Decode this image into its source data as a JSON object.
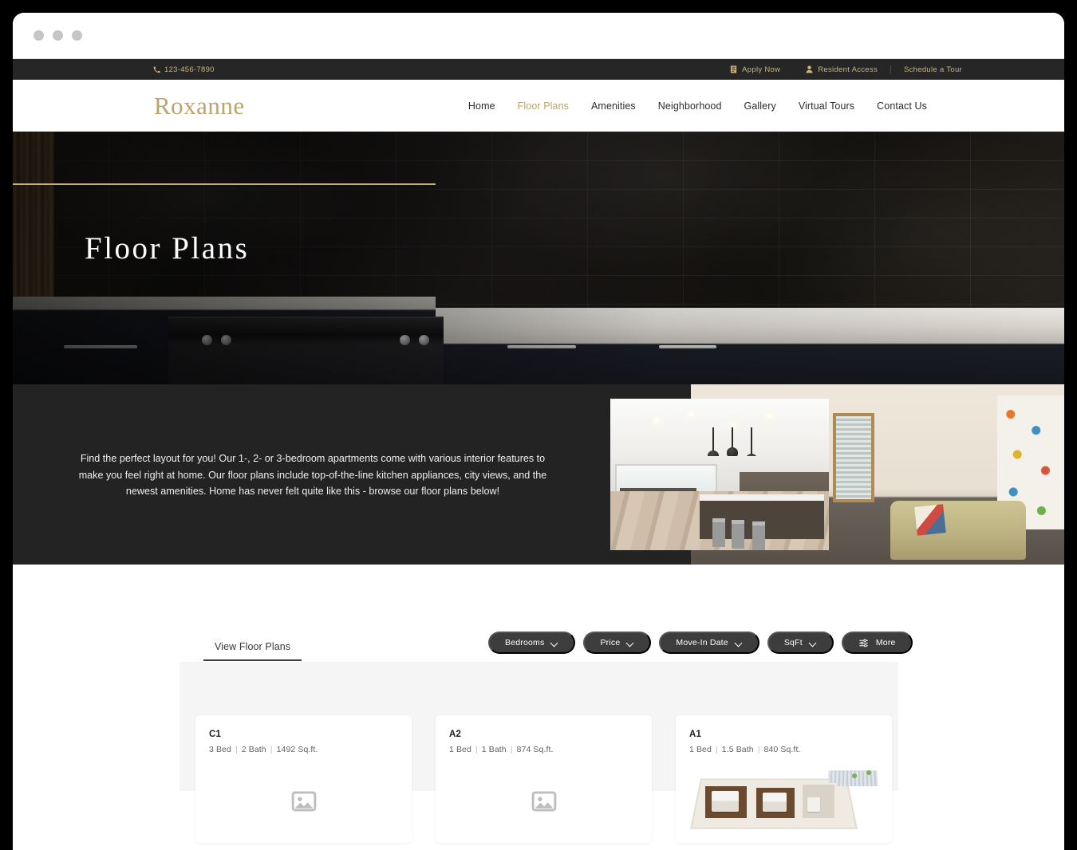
{
  "window": {
    "dots": [
      "close",
      "minimize",
      "maximize"
    ]
  },
  "utility_bar": {
    "phone_icon": "phone-icon",
    "phone": "123-456-7890",
    "links": [
      {
        "label": "Apply Now",
        "icon": "document-icon"
      },
      {
        "label": "Resident Access",
        "icon": "user-icon"
      },
      {
        "label": "Schedule a Tour",
        "icon": ""
      }
    ]
  },
  "header": {
    "brand": "Roxanne",
    "nav": [
      {
        "label": "Home",
        "active": false
      },
      {
        "label": "Floor Plans",
        "active": true
      },
      {
        "label": "Amenities",
        "active": false
      },
      {
        "label": "Neighborhood",
        "active": false
      },
      {
        "label": "Gallery",
        "active": false
      },
      {
        "label": "Virtual Tours",
        "active": false
      },
      {
        "label": "Contact Us",
        "active": false
      }
    ]
  },
  "hero": {
    "title": "Floor Plans",
    "image_alt": "dark-subway-tile-kitchen-photo"
  },
  "intro": {
    "paragraph": "Find the perfect layout for you! Our 1-, 2- or 3-bedroom apartments come with various interior features to make you feel right at home. Our floor plans include top-of-the-line kitchen appliances, city views, and the newest amenities. Home has never felt quite like this - browse our floor plans below!",
    "image_front_alt": "open-plan-kitchen-island-photo",
    "image_back_alt": "living-room-fireplace-photo"
  },
  "listings": {
    "tab": "View Floor Plans",
    "filters": [
      {
        "label": "Bedrooms",
        "icon": "chevron-down-icon"
      },
      {
        "label": "Price",
        "icon": "chevron-down-icon"
      },
      {
        "label": "Move-In Date",
        "icon": "chevron-down-icon"
      },
      {
        "label": "SqFt",
        "icon": "chevron-down-icon"
      },
      {
        "label": "More",
        "icon": "sliders-icon"
      }
    ],
    "cards": [
      {
        "name": "C1",
        "beds": "3 Bed",
        "baths": "2 Bath",
        "sqft": "1492 Sq.ft.",
        "media": "placeholder"
      },
      {
        "name": "A2",
        "beds": "1 Bed",
        "baths": "1 Bath",
        "sqft": "874 Sq.ft.",
        "media": "placeholder"
      },
      {
        "name": "A1",
        "beds": "1 Bed",
        "baths": "1.5 Bath",
        "sqft": "840 Sq.ft.",
        "media": "floorplan"
      }
    ]
  },
  "colors": {
    "gold": "#bda46a",
    "gold_light": "#cbb57c",
    "dark": "#232323",
    "utility_dark": "#262626",
    "pill": "#3d3d3d",
    "panel": "#f5f5f5"
  }
}
